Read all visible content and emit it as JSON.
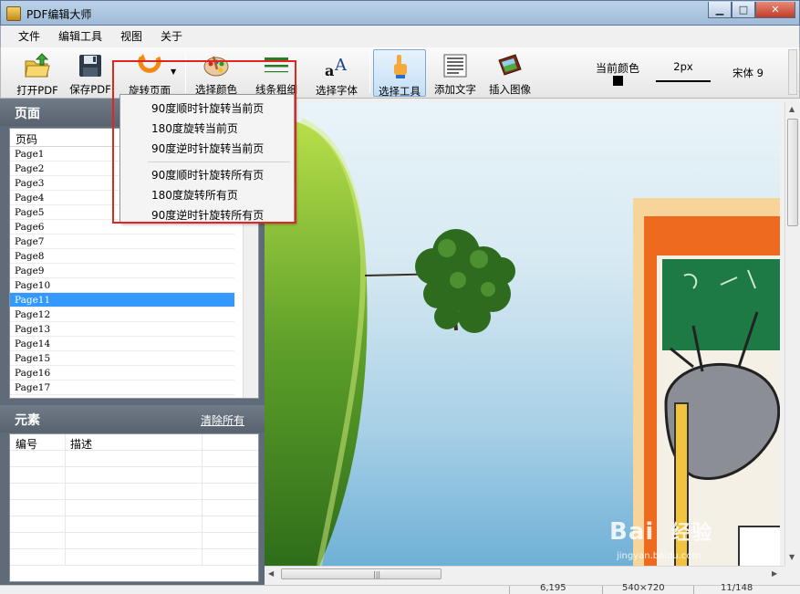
{
  "window": {
    "title": "PDF编辑大师",
    "min_glyph": "▁",
    "max_glyph": "□",
    "close_glyph": "✕"
  },
  "menu": [
    "文件",
    "编辑工具",
    "视图",
    "关于"
  ],
  "toolbar": {
    "open_pdf": "打开PDF",
    "save_pdf": "保存PDF",
    "rotate_page": "旋转页面",
    "select_color": "选择颜色",
    "line_width_tool": "线条粗细",
    "select_font": "选择字体",
    "select_tool": "选择工具",
    "add_text": "添加文字",
    "insert_image": "插入图像",
    "current_color_label": "当前颜色",
    "current_color": "#000000",
    "line_width_value": "2px",
    "font_value": "宋体 9"
  },
  "pages_panel": {
    "title": "页面",
    "column_header": "页码",
    "pages": [
      "Page1",
      "Page2",
      "Page3",
      "Page4",
      "Page5",
      "Page6",
      "Page7",
      "Page8",
      "Page9",
      "Page10",
      "Page11",
      "Page12",
      "Page13",
      "Page14",
      "Page15",
      "Page16",
      "Page17"
    ],
    "selected": "Page11"
  },
  "elements_panel": {
    "title": "元素",
    "clear_all": "清除所有",
    "col_id": "编号",
    "col_desc": "描述"
  },
  "rotate_menu": {
    "items_current": [
      "90度顺时针旋转当前页",
      "180度旋转当前页",
      "90度逆时针旋转当前页"
    ],
    "items_all": [
      "90度顺时针旋转所有页",
      "180度旋转所有页",
      "90度逆时针旋转所有页"
    ]
  },
  "statusbar": {
    "coords": "6,195",
    "size": "540×720",
    "page": "11/148"
  },
  "watermark": {
    "brand": "Bai",
    "brand_cn": "经验",
    "url": "jingyan.baidu.com"
  },
  "colors": {
    "selection": "#3399ff",
    "highlight": "#e0261f",
    "panel": "#5f6b78"
  }
}
